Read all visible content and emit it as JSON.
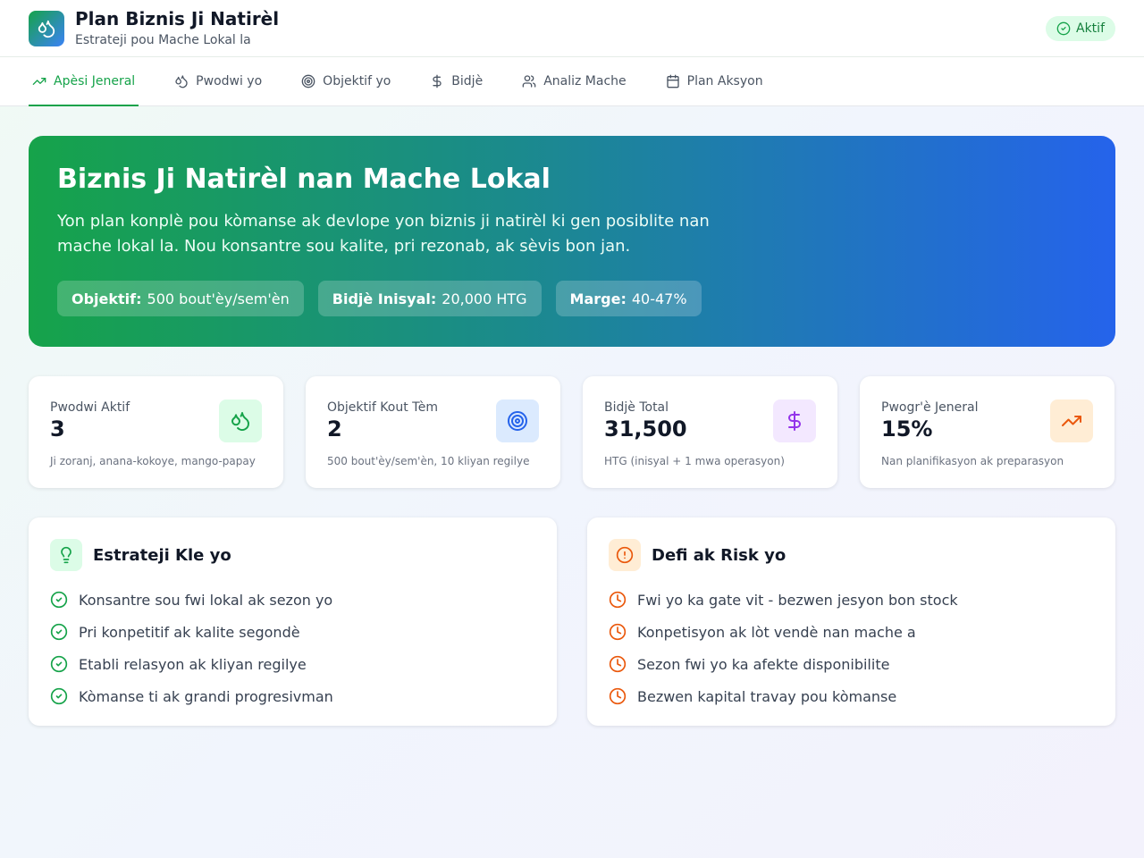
{
  "header": {
    "title": "Plan Biznis Ji Natirèl",
    "subtitle": "Estrateji pou Mache Lokal la",
    "status": "Aktif"
  },
  "tabs": [
    {
      "label": "Apèsi Jeneral",
      "icon": "trending-up-icon",
      "active": true
    },
    {
      "label": "Pwodwi yo",
      "icon": "droplets-icon",
      "active": false
    },
    {
      "label": "Objektif yo",
      "icon": "target-icon",
      "active": false
    },
    {
      "label": "Bidjè",
      "icon": "dollar-icon",
      "active": false
    },
    {
      "label": "Analiz Mache",
      "icon": "users-icon",
      "active": false
    },
    {
      "label": "Plan Aksyon",
      "icon": "calendar-icon",
      "active": false
    }
  ],
  "hero": {
    "title": "Biznis Ji Natirèl nan Mache Lokal",
    "description": "Yon plan konplè pou kòmanse ak devlope yon biznis ji natirèl ki gen posiblite nan mache lokal la. Nou konsantre sou kalite, pri rezonab, ak sèvis bon jan.",
    "pills": [
      {
        "label": "Objektif:",
        "value": "500 bout'èy/sem'èn"
      },
      {
        "label": "Bidjè Inisyal:",
        "value": "20,000 HTG"
      },
      {
        "label": "Marge:",
        "value": "40-47%"
      }
    ]
  },
  "stats": [
    {
      "label": "Pwodwi Aktif",
      "value": "3",
      "note": "Ji zoranj, anana-kokoye, mango-papay",
      "icon": "droplets-icon",
      "icon_bg": "#dcfce7",
      "icon_color": "#16a34a"
    },
    {
      "label": "Objektif Kout Tèm",
      "value": "2",
      "note": "500 bout'èy/sem'èn, 10 kliyan regilye",
      "icon": "target-icon",
      "icon_bg": "#dbeafe",
      "icon_color": "#2563eb"
    },
    {
      "label": "Bidjè Total",
      "value": "31,500",
      "note": "HTG (inisyal + 1 mwa operasyon)",
      "icon": "dollar-icon",
      "icon_bg": "#f3e8ff",
      "icon_color": "#9333ea"
    },
    {
      "label": "Pwogr'è Jeneral",
      "value": "15%",
      "note": "Nan planifikasyon ak preparasyon",
      "icon": "trending-up-icon",
      "icon_bg": "#ffedd5",
      "icon_color": "#ea580c"
    }
  ],
  "strategies": {
    "title": "Estrateji Kle yo",
    "icon": "lightbulb-icon",
    "items": [
      "Konsantre sou fwi lokal ak sezon yo",
      "Pri konpetitif ak kalite segondè",
      "Etabli relasyon ak kliyan regilye",
      "Kòmanse ti ak grandi progresivman"
    ]
  },
  "risks": {
    "title": "Defi ak Risk yo",
    "icon": "alert-circle-icon",
    "items": [
      "Fwi yo ka gate vit - bezwen jesyon bon stock",
      "Konpetisyon ak lòt vendè nan mache a",
      "Sezon fwi yo ka afekte disponibilite",
      "Bezwen kapital travay pou kòmanse"
    ]
  },
  "colors": {
    "accent": "#16a34a",
    "hero_start": "#16a34a",
    "hero_end": "#2563eb",
    "risk": "#ea580c"
  }
}
